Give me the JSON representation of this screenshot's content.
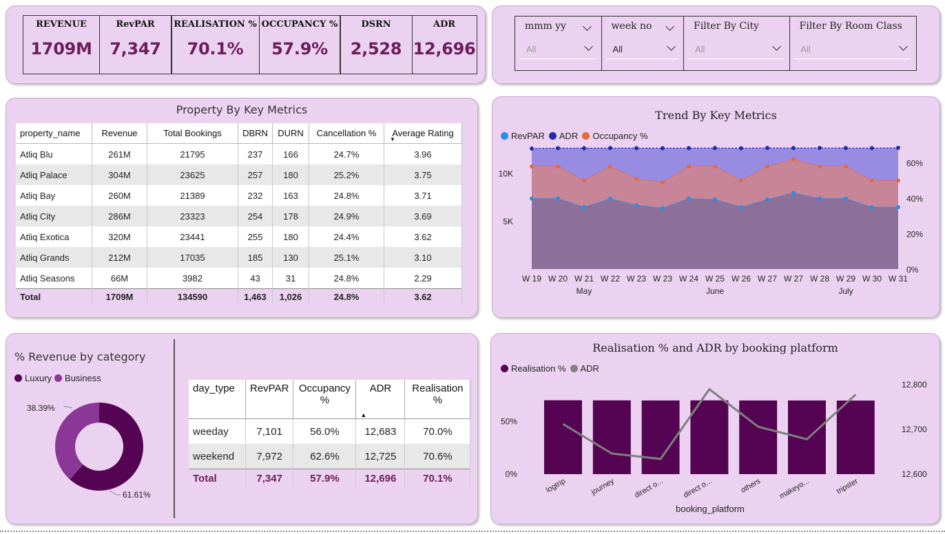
{
  "kpis": [
    {
      "label": "REVENUE",
      "value": "1709M"
    },
    {
      "label": "RevPAR",
      "value": "7,347"
    },
    {
      "label": "REALISATION %",
      "value": "70.1%"
    },
    {
      "label": "OCCUPANCY %",
      "value": "57.9%"
    },
    {
      "label": "DSRN",
      "value": "2,528"
    },
    {
      "label": "ADR",
      "value": "12,696"
    }
  ],
  "filters": [
    {
      "title": "mmm yy",
      "value": "All"
    },
    {
      "title": "week no",
      "value": "All"
    },
    {
      "title": "Filter By City",
      "value": "All"
    },
    {
      "title": "Filter By Room Class",
      "value": "All"
    }
  ],
  "property": {
    "title": "Property By Key Metrics",
    "columns": [
      "property_name",
      "Revenue",
      "Total Bookings",
      "DBRN",
      "DURN",
      "Cancellation %",
      "Average Rating"
    ],
    "rows": [
      [
        "Atliq Blu",
        "261M",
        "21795",
        "237",
        "166",
        "24.7%",
        "3.96"
      ],
      [
        "Atliq Palace",
        "304M",
        "23625",
        "257",
        "180",
        "25.2%",
        "3.75"
      ],
      [
        "Atliq Bay",
        "260M",
        "21389",
        "232",
        "163",
        "24.8%",
        "3.71"
      ],
      [
        "Atliq City",
        "286M",
        "23323",
        "254",
        "178",
        "24.9%",
        "3.69"
      ],
      [
        "Atliq Exotica",
        "320M",
        "23441",
        "255",
        "180",
        "24.4%",
        "3.62"
      ],
      [
        "Atliq Grands",
        "212M",
        "17035",
        "185",
        "130",
        "25.1%",
        "3.10"
      ],
      [
        "Atliq Seasons",
        "66M",
        "3982",
        "43",
        "31",
        "24.8%",
        "2.29"
      ]
    ],
    "total": [
      "Total",
      "1709M",
      "134590",
      "1,463",
      "1,026",
      "24.8%",
      "3.62"
    ]
  },
  "trend": {
    "title": "Trend By Key Metrics",
    "legend": [
      {
        "name": "RevPAR",
        "color": "#2b8de6"
      },
      {
        "name": "ADR",
        "color": "#1f2ea3"
      },
      {
        "name": "Occupancy %",
        "color": "#e5693a"
      }
    ],
    "left_ticks": [
      "10K",
      "5K"
    ],
    "right_ticks": [
      "60%",
      "40%",
      "20%",
      "0%"
    ],
    "months": [
      "May",
      "June",
      "July"
    ]
  },
  "category": {
    "title": "% Revenue by category",
    "legend": [
      {
        "name": "Luxury",
        "color": "#540452"
      },
      {
        "name": "Business",
        "color": "#8b3797"
      }
    ],
    "label_business": "38.39%",
    "label_luxury": "61.61%"
  },
  "daytype": {
    "columns": [
      "day_type",
      "RevPAR",
      "Occupancy %",
      "ADR",
      "Realisation %"
    ],
    "rows": [
      [
        "weeday",
        "7,101",
        "56.0%",
        "12,683",
        "70.0%"
      ],
      [
        "weekend",
        "7,972",
        "62.6%",
        "12,725",
        "70.6%"
      ]
    ],
    "total": [
      "Total",
      "7,347",
      "57.9%",
      "12,696",
      "70.1%"
    ]
  },
  "platform": {
    "title": "Realisation % and ADR by booking platform",
    "legend": [
      {
        "name": "Realisation %",
        "color": "#540452"
      },
      {
        "name": "ADR",
        "color": "#808080"
      }
    ],
    "left_ticks": [
      "50%",
      "0%"
    ],
    "right_ticks": [
      "12,800",
      "12,700",
      "12,600"
    ],
    "xlabel": "booking_platform"
  },
  "chart_data": [
    {
      "type": "area",
      "title": "Trend By Key Metrics",
      "categories": [
        "W 19",
        "W 20",
        "W 21",
        "W 22",
        "W 23",
        "W 23",
        "W 24",
        "W 25",
        "W 26",
        "W 27",
        "W 27",
        "W 28",
        "W 29",
        "W 30",
        "W 31"
      ],
      "series": [
        {
          "name": "ADR",
          "axis": "left",
          "values": [
            12650,
            12690,
            12680,
            12700,
            12690,
            12680,
            12690,
            12700,
            12680,
            12710,
            12700,
            12710,
            12700,
            12690,
            12720
          ]
        },
        {
          "name": "Occupancy %",
          "axis": "right",
          "values": [
            58,
            58,
            50,
            58,
            51,
            49,
            58,
            58,
            50,
            58,
            62,
            58,
            58,
            50,
            50
          ]
        },
        {
          "name": "RevPAR",
          "axis": "left",
          "values": [
            7400,
            7400,
            6500,
            7400,
            6700,
            6400,
            7400,
            7300,
            6500,
            7300,
            8000,
            7400,
            7400,
            6500,
            6500
          ]
        }
      ],
      "ylim_left": [
        0,
        13000
      ],
      "ylim_right": [
        0,
        70
      ]
    },
    {
      "type": "pie",
      "title": "% Revenue by category",
      "categories": [
        "Luxury",
        "Business"
      ],
      "values": [
        61.61,
        38.39
      ]
    },
    {
      "type": "bar",
      "title": "Realisation % and ADR by booking platform",
      "categories": [
        "logtrip",
        "journey",
        "direct o...",
        "direct o...",
        "others",
        "makeyo...",
        "tripster"
      ],
      "series": [
        {
          "name": "Realisation %",
          "axis": "left",
          "values": [
            70.2,
            70.1,
            70.0,
            70.1,
            70.0,
            70.0,
            69.9
          ]
        },
        {
          "name": "ADR",
          "axis": "right",
          "values": [
            12712,
            12646,
            12634,
            12790,
            12706,
            12678,
            12778
          ]
        }
      ],
      "xlabel": "booking_platform",
      "ylim_left": [
        0,
        85
      ],
      "ylim_right": [
        12600,
        12800
      ]
    }
  ]
}
